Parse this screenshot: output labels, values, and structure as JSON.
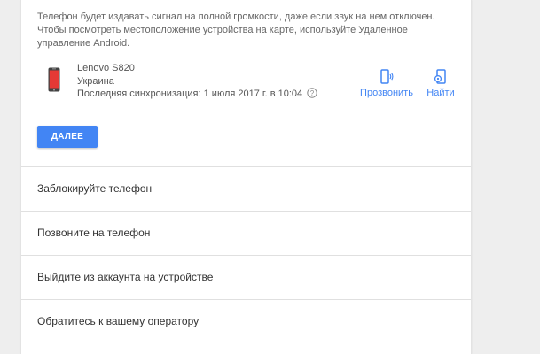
{
  "description": {
    "line1": "Телефон будет издавать сигнал на полной громкости, даже если звук на нем отключен.",
    "line2": "Чтобы посмотреть местоположение устройства на карте, используйте Удаленное",
    "line3": "управление Android."
  },
  "device": {
    "name": "Lenovo S820",
    "country": "Украина",
    "last_sync": "Последняя синхронизация: 1 июля 2017 г. в 10:04",
    "icon": "phone-icon"
  },
  "actions": {
    "ring_label": "Прозвонить",
    "ring_icon": "ring-phone-icon",
    "find_label": "Найти",
    "find_icon": "locate-phone-icon"
  },
  "next_button": {
    "label": "ДАЛЕЕ"
  },
  "options": [
    {
      "label": "Заблокируйте телефон"
    },
    {
      "label": "Позвоните на телефон"
    },
    {
      "label": "Выйдите из аккаунта на устройстве"
    },
    {
      "label": "Обратитесь к вашему оператору"
    }
  ],
  "colors": {
    "accent": "#4285f4",
    "phone_red": "#e53935",
    "background": "#eeeeee"
  }
}
